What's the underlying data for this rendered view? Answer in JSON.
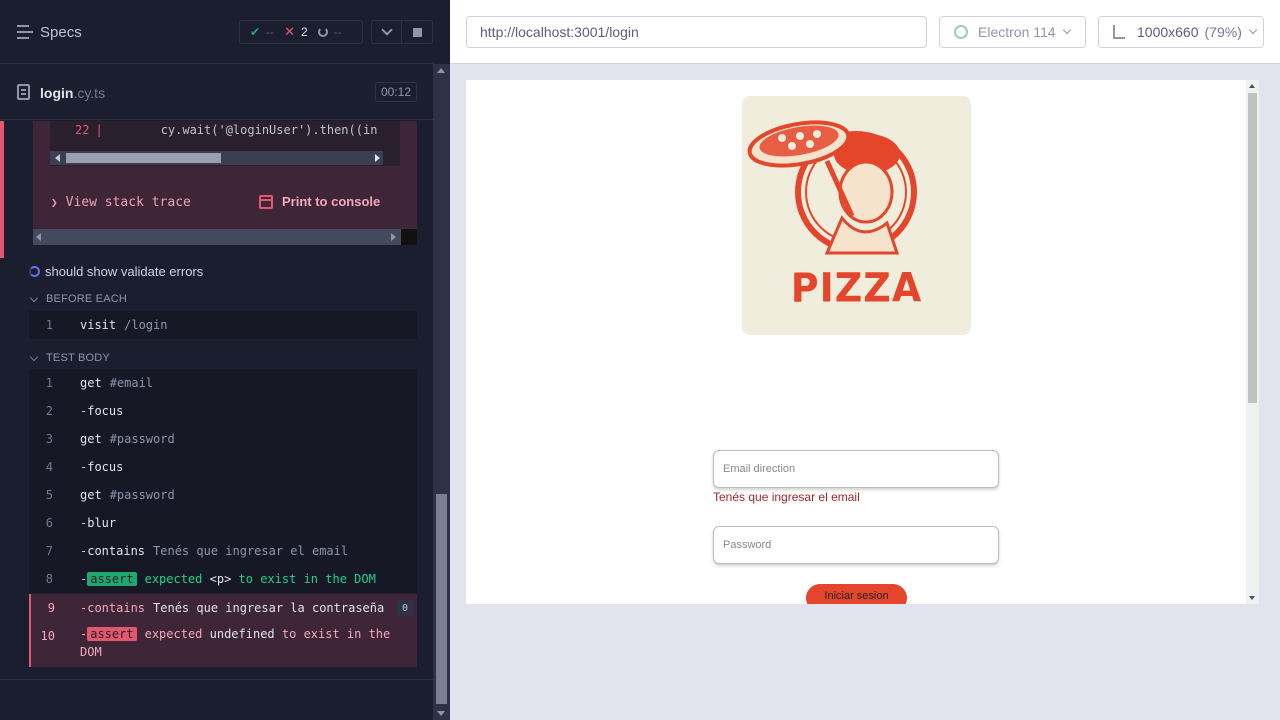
{
  "reporter": {
    "specs_title": "Specs",
    "stats": {
      "passed": "--",
      "failed": "2",
      "pending": "--"
    },
    "spec": {
      "name": "login",
      "ext": ".cy.ts",
      "duration": "00:12"
    },
    "error": {
      "line_number": "22",
      "code": "cy.wait('@loginUser').then((in",
      "view_stack": "View stack trace",
      "print_console": "Print to console"
    },
    "test_title": "should show validate errors",
    "before_each": {
      "label": "BEFORE EACH",
      "commands": [
        {
          "n": "1",
          "name": "visit",
          "msg": "/login"
        }
      ]
    },
    "test_body": {
      "label": "TEST BODY",
      "commands": [
        {
          "n": "1",
          "name": "get",
          "msg": "#email"
        },
        {
          "n": "2",
          "name": "focus",
          "msg": ""
        },
        {
          "n": "3",
          "name": "get",
          "msg": "#password"
        },
        {
          "n": "4",
          "name": "focus",
          "msg": ""
        },
        {
          "n": "5",
          "name": "get",
          "msg": "#password"
        },
        {
          "n": "6",
          "name": "blur",
          "msg": ""
        },
        {
          "n": "7",
          "name": "contains",
          "msg": "Tenés que ingresar el email"
        },
        {
          "n": "8",
          "name": "assert",
          "msg_pre": "expected",
          "msg_sel": "<p>",
          "msg_post": "to exist in the DOM"
        },
        {
          "n": "9",
          "name": "contains",
          "msg": "Tenés que ingresar la contraseña",
          "badge": "0"
        },
        {
          "n": "10",
          "name": "assert",
          "msg_pre": "expected",
          "msg_sel": "undefined",
          "msg_post": "to exist in the",
          "msg_wrap": "DOM"
        }
      ]
    }
  },
  "aut": {
    "url": "http://localhost:3001/login",
    "browser": "Electron 114",
    "viewport": "1000x660",
    "viewport_pct": "(79%)",
    "logo_text": "PIZZA",
    "email_placeholder": "Email direction",
    "email_error": "Tenés que ingresar el email",
    "password_placeholder": "Password",
    "login_button": "Iniciar sesion"
  },
  "colors": {
    "accent_red": "#e45770",
    "pass_green": "#1fa971",
    "brand_red": "#e5462b"
  }
}
